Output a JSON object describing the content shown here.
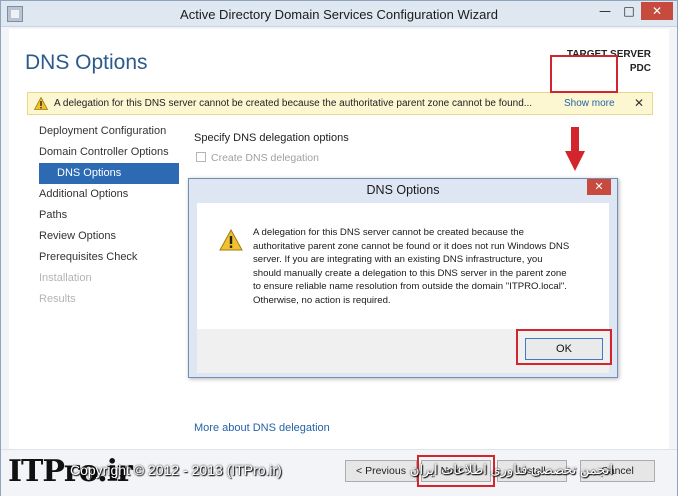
{
  "window": {
    "title": "Active Directory Domain Services Configuration Wizard",
    "min_glyph": "—",
    "max_glyph": "□",
    "close_glyph": "✕"
  },
  "page": {
    "title": "DNS Options",
    "target_server_label": "TARGET SERVER",
    "target_server_name": "PDC"
  },
  "banner": {
    "text": "A delegation for this DNS server cannot be created because the authoritative parent zone cannot be found...",
    "show_more": "Show more",
    "close_glyph": "✕"
  },
  "sidebar": {
    "items": [
      {
        "label": "Deployment Configuration",
        "state": "normal"
      },
      {
        "label": "Domain Controller Options",
        "state": "normal"
      },
      {
        "label": "DNS Options",
        "state": "active"
      },
      {
        "label": "Additional Options",
        "state": "normal"
      },
      {
        "label": "Paths",
        "state": "normal"
      },
      {
        "label": "Review Options",
        "state": "normal"
      },
      {
        "label": "Prerequisites Check",
        "state": "normal"
      },
      {
        "label": "Installation",
        "state": "disabled"
      },
      {
        "label": "Results",
        "state": "disabled"
      }
    ]
  },
  "main": {
    "heading": "Specify DNS delegation options",
    "checkbox_label": "Create DNS delegation",
    "more_link": "More about DNS delegation"
  },
  "dialog": {
    "title": "DNS Options",
    "close_glyph": "✕",
    "message": "A delegation for this DNS server cannot be created because the authoritative parent zone cannot be found or it does not run Windows DNS server. If you are integrating with an existing DNS infrastructure, you should manually create a delegation to this DNS server in the parent zone to ensure reliable name resolution from outside the domain \"ITPRO.local\". Otherwise, no action is required.",
    "ok_label": "OK"
  },
  "footer": {
    "previous_label": "< Previous",
    "next_label": "Next >",
    "install_label": "Install",
    "cancel_label": "Cancel"
  },
  "watermark": {
    "logo": "ITPro.ir",
    "copyright": "Copyright © 2012 - 2013 (ITPro.ir)",
    "persian": "انجمن تخصصی فناوری اطلاعات ایران"
  },
  "colors": {
    "accent": "#2c6bb3",
    "title_blue": "#2b5a8c",
    "highlight_red": "#d3252c",
    "warning_yellow": "#fcf7d1"
  }
}
